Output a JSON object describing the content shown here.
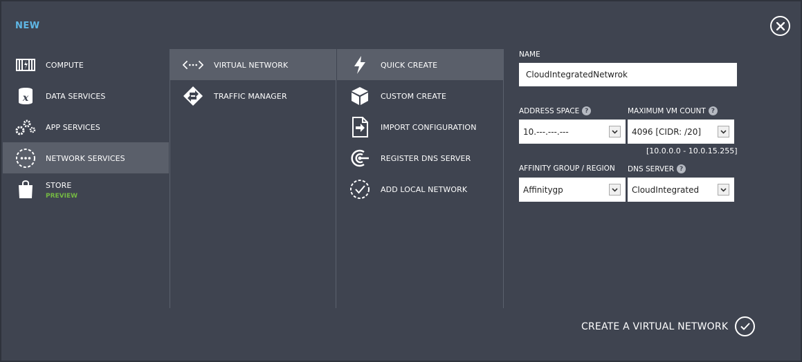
{
  "header": {
    "title": "NEW"
  },
  "categories": [
    {
      "label": "COMPUTE",
      "icon": "compute-icon"
    },
    {
      "label": "DATA SERVICES",
      "icon": "data-services-icon"
    },
    {
      "label": "APP SERVICES",
      "icon": "app-services-icon"
    },
    {
      "label": "NETWORK SERVICES",
      "icon": "network-services-icon",
      "selected": true
    },
    {
      "label": "STORE",
      "sub": "PREVIEW",
      "icon": "store-bag-icon"
    }
  ],
  "network_items": [
    {
      "label": "VIRTUAL NETWORK",
      "icon": "virtual-network-icon",
      "selected": true
    },
    {
      "label": "TRAFFIC MANAGER",
      "icon": "traffic-manager-icon"
    }
  ],
  "actions": [
    {
      "label": "QUICK CREATE",
      "icon": "lightning-icon",
      "selected": true
    },
    {
      "label": "CUSTOM CREATE",
      "icon": "box-icon"
    },
    {
      "label": "IMPORT CONFIGURATION",
      "icon": "import-file-icon"
    },
    {
      "label": "REGISTER DNS SERVER",
      "icon": "dns-icon"
    },
    {
      "label": "ADD LOCAL NETWORK",
      "icon": "local-network-icon"
    }
  ],
  "form": {
    "name_label": "NAME",
    "name_value": "CloudIntegratedNetwrok",
    "address_label": "ADDRESS SPACE",
    "address_value": "10.---.---.---",
    "vmcount_label": "MAXIMUM VM COUNT",
    "vmcount_value": "4096 [CIDR: /20]",
    "range_text": "[10.0.0.0 - 10.0.15.255]",
    "affinity_label": "AFFINITY GROUP / REGION",
    "affinity_value": "Affinitygp",
    "dns_label": "DNS SERVER",
    "dns_value": "CloudIntegrated",
    "help_glyph": "?"
  },
  "footer": {
    "create_label": "CREATE A VIRTUAL NETWORK"
  },
  "colors": {
    "accent": "#5fb7e5",
    "preview": "#74b843",
    "background": "#3f4450",
    "selected": "#5a5f6a"
  }
}
